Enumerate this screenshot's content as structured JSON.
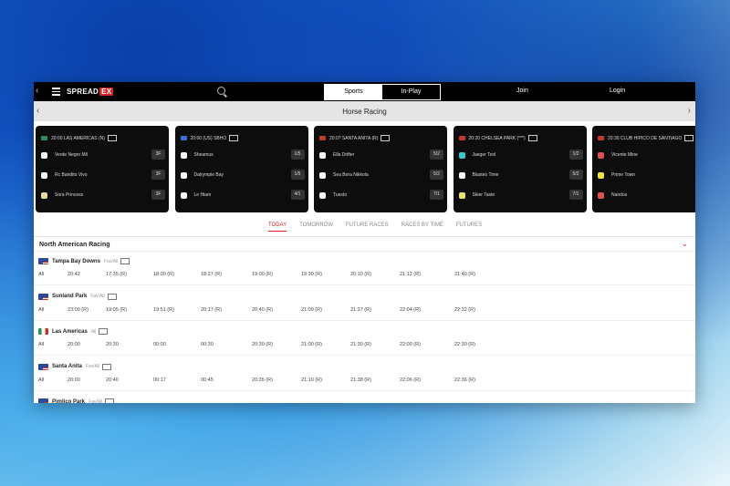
{
  "topbar": {
    "logo_main": "SPREAD",
    "logo_badge": "EX",
    "tabs": [
      {
        "label": "Sports",
        "active": true
      },
      {
        "label": "In-Play",
        "active": false
      }
    ],
    "join_label": "Join",
    "login_label": "Login"
  },
  "subbar": {
    "title": "Horse Racing"
  },
  "cards": [
    {
      "title": "20:00 LAS AMERICAS (N)",
      "flag_color": "#2e8b57",
      "runners": [
        {
          "name": "Verde Negro Mil",
          "odds": "3F",
          "silk": "#f5f5f5"
        },
        {
          "name": "Rc Bandito Vivo",
          "odds": "3F",
          "silk": "#f5f5f5"
        },
        {
          "name": "Sora Princess",
          "odds": "3F",
          "silk": "#e8d9a0"
        }
      ]
    },
    {
      "title": "20:00 (US) SBHO",
      "flag_color": "#3b6fd8",
      "runners": [
        {
          "name": "Sheamus",
          "odds": "1/5",
          "silk": "#f5f5f5"
        },
        {
          "name": "Dalrymple Bay",
          "odds": "1/5",
          "silk": "#f5f5f5"
        },
        {
          "name": "Le Hiam",
          "odds": "4/1",
          "silk": "#f5f5f5"
        }
      ]
    },
    {
      "title": "20:0? SANTA ANITA (R)",
      "flag_color": "#c0392b",
      "runners": [
        {
          "name": "Ella Drifter",
          "odds": "5/2",
          "silk": "#f5f5f5"
        },
        {
          "name": "Sea Bora Nikkola",
          "odds": "5/2",
          "silk": "#f5f5f5"
        },
        {
          "name": "Tuesto",
          "odds": "7/1",
          "silk": "#f5f5f5"
        }
      ]
    },
    {
      "title": "20:20 CHELSEA PARK (***)",
      "flag_color": "#c0392b",
      "runners": [
        {
          "name": "Jaeger Tool",
          "odds": "1/2",
          "silk": "#3cc7c7"
        },
        {
          "name": "Blasteo Time",
          "odds": "5/2",
          "silk": "#f5f5f5"
        },
        {
          "name": "Skier Taste",
          "odds": "7/1",
          "silk": "#e8e070"
        }
      ]
    },
    {
      "title": "20:30 CLUB HIPICO DE SANTIAGO",
      "flag_color": "#c0392b",
      "runners": [
        {
          "name": "Vicente Mine",
          "odds": "",
          "silk": "#e05050"
        },
        {
          "name": "Prime Town",
          "odds": "",
          "silk": "#f0e040"
        },
        {
          "name": "Nandos",
          "odds": "",
          "silk": "#e05050"
        }
      ]
    }
  ],
  "date_tabs": [
    {
      "label": "TODAY",
      "active": true
    },
    {
      "label": "TOMORROW",
      "active": false
    },
    {
      "label": "FUTURE RACES",
      "active": false
    },
    {
      "label": "RACES BY TIME",
      "active": false
    },
    {
      "label": "FUTURES",
      "active": false
    }
  ],
  "section": {
    "title": "North American Racing"
  },
  "meetings": [
    {
      "name": "Tampa Bay Downs",
      "sub": "Fav/All",
      "flag": "us",
      "times": [
        "All",
        "20:42",
        "17:35 (R)",
        "18:00 (R)",
        "18:27 (R)",
        "19:00 (R)",
        "19:30 (R)",
        "20:10 (R)",
        "21:12 (R)",
        "21:40 (R)"
      ]
    },
    {
      "name": "Sunland Park",
      "sub": "Fav/All",
      "flag": "us",
      "times": [
        "All",
        "23:00 (R)",
        "19:05 (R)",
        "19:51 (R)",
        "20:17 (R)",
        "20:40 (R)",
        "21:09 (R)",
        "21:37 (R)",
        "22:04 (R)",
        "22:32 (R)"
      ]
    },
    {
      "name": "Las Americas",
      "sub": "All",
      "flag": "mx",
      "times": [
        "All",
        "20:00",
        "20:30",
        "00:00",
        "00:30",
        "20:30 (R)",
        "21:00 (R)",
        "21:30 (R)",
        "22:00 (R)",
        "22:30 (R)"
      ]
    },
    {
      "name": "Santa Anita",
      "sub": "Fav/All",
      "flag": "us",
      "times": [
        "All",
        "20:00",
        "20:40",
        "00:17",
        "00:45",
        "20:35 (R)",
        "21:10 (R)",
        "21:38 (R)",
        "22:06 (R)",
        "22:36 (R)"
      ]
    },
    {
      "name": "Pimlico Park",
      "sub": "Fav/All",
      "flag": "us",
      "times": []
    }
  ],
  "colors": {
    "accent": "#d2242a",
    "topbar_bg": "#000000",
    "card_bg": "#0d0d0d"
  }
}
